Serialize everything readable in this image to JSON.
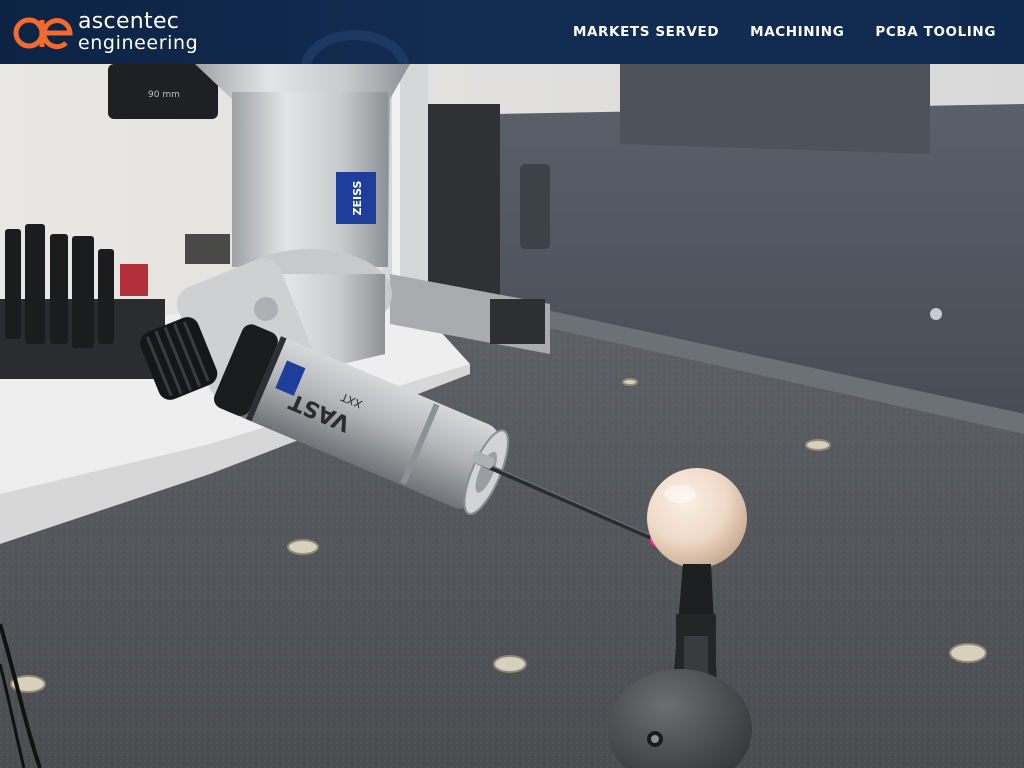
{
  "brand": {
    "line1": "ascentec",
    "line2": "engineering",
    "accent_color": "#f26a2d",
    "header_color": "#0d2344"
  },
  "nav": {
    "items": [
      {
        "label": "MARKETS SERVED"
      },
      {
        "label": "MACHINING"
      },
      {
        "label": "PCBA TOOLING"
      }
    ]
  },
  "hero": {
    "photo_subject": "coordinate measuring machine probe touching a calibration sphere",
    "labels": {
      "head_brand": "ZEISS",
      "probe_model": "VAST",
      "probe_variant": "XXT",
      "lens_marking": "90 mm"
    }
  }
}
